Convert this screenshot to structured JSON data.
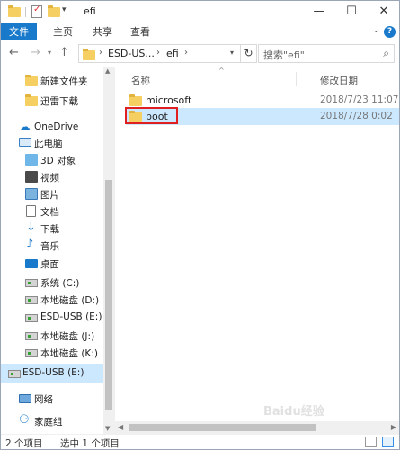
{
  "window": {
    "title": "efi",
    "minimize": "—",
    "maximize": "☐",
    "close": "✕"
  },
  "ribbon": {
    "file": "文件",
    "home": "主页",
    "share": "共享",
    "view": "查看",
    "help": "?"
  },
  "address": {
    "segments": [
      "ESD-US...",
      "efi"
    ],
    "refresh": "↻"
  },
  "search": {
    "placeholder": "搜索\"efi\""
  },
  "nav": {
    "items": [
      {
        "label": "新建文件夹",
        "icon": "folder-icon"
      },
      {
        "label": "迅雷下载",
        "icon": "folder-icon"
      },
      {
        "label": "OneDrive",
        "icon": "onedrive-icon"
      },
      {
        "label": "此电脑",
        "icon": "pc-icon"
      },
      {
        "label": "3D 对象",
        "icon": "3d-objects-icon"
      },
      {
        "label": "视频",
        "icon": "video-icon"
      },
      {
        "label": "图片",
        "icon": "pictures-icon"
      },
      {
        "label": "文档",
        "icon": "documents-icon"
      },
      {
        "label": "下载",
        "icon": "download-icon"
      },
      {
        "label": "音乐",
        "icon": "music-icon"
      },
      {
        "label": "桌面",
        "icon": "desktop-icon"
      },
      {
        "label": "系统 (C:)",
        "icon": "drive-icon"
      },
      {
        "label": "本地磁盘 (D:)",
        "icon": "drive-icon"
      },
      {
        "label": "ESD-USB (E:)",
        "icon": "usb-drive-icon"
      },
      {
        "label": "本地磁盘 (J:)",
        "icon": "drive-icon"
      },
      {
        "label": "本地磁盘 (K:)",
        "icon": "drive-icon"
      },
      {
        "label": "ESD-USB (E:)",
        "icon": "usb-drive-icon"
      },
      {
        "label": "网络",
        "icon": "network-icon"
      },
      {
        "label": "家庭组",
        "icon": "homegroup-icon"
      }
    ]
  },
  "columns": {
    "name": "名称",
    "modified": "修改日期"
  },
  "files": [
    {
      "name": "microsoft",
      "modified": "2018/7/23 11:07"
    },
    {
      "name": "boot",
      "modified": "2018/7/28 0:02"
    }
  ],
  "status": {
    "count": "2 个项目",
    "selected": "选中 1 个项目"
  },
  "watermark": "Baidu经验",
  "colors": {
    "accent": "#1979ca",
    "selection": "#cce8ff",
    "highlight": "#e02020",
    "folder": "#f5cf62"
  }
}
